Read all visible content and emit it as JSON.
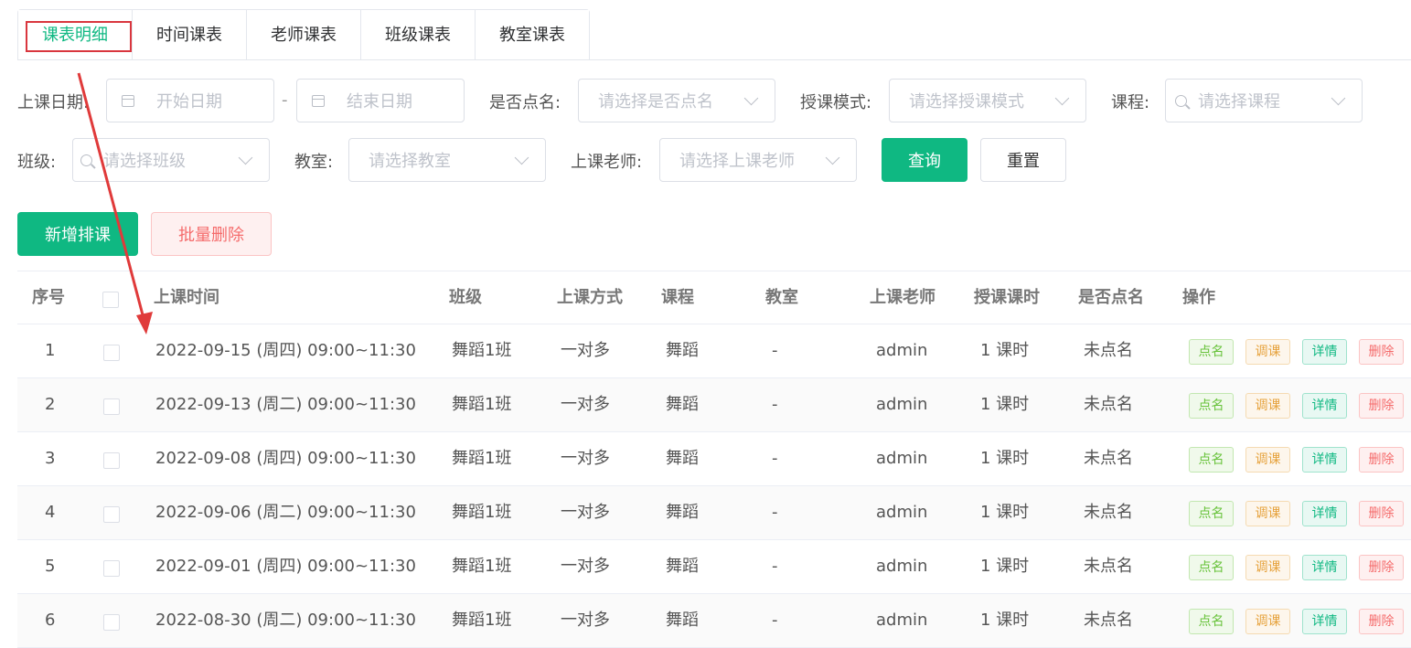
{
  "tabs": [
    "课表明细",
    "时间课表",
    "老师课表",
    "班级课表",
    "教室课表"
  ],
  "filters": {
    "date_label": "上课日期:",
    "start_placeholder": "开始日期",
    "date_sep": "-",
    "end_placeholder": "结束日期",
    "rollcall_label": "是否点名:",
    "rollcall_placeholder": "请选择是否点名",
    "mode_label": "授课模式:",
    "mode_placeholder": "请选择授课模式",
    "course_label": "课程:",
    "course_placeholder": "请选择课程",
    "class_label": "班级:",
    "class_placeholder": "请选择班级",
    "room_label": "教室:",
    "room_placeholder": "请选择教室",
    "teacher_label": "上课老师:",
    "teacher_placeholder": "请选择上课老师",
    "query_button": "查询",
    "reset_button": "重置"
  },
  "actions": {
    "add_button": "新增排课",
    "batch_delete_button": "批量删除"
  },
  "table": {
    "headers": {
      "index": "序号",
      "time": "上课时间",
      "class": "班级",
      "method": "上课方式",
      "course": "课程",
      "room": "教室",
      "teacher": "上课老师",
      "hours": "授课课时",
      "rollcall": "是否点名",
      "ops": "操作"
    },
    "row_actions": {
      "rollcall": "点名",
      "adjust": "调课",
      "detail": "详情",
      "delete": "删除"
    },
    "rows": [
      {
        "index": "1",
        "time": "2022-09-15 (周四) 09:00~11:30",
        "class": "舞蹈1班",
        "method": "一对多",
        "course": "舞蹈",
        "room": "-",
        "teacher": "admin",
        "hours": "1 课时",
        "rollcall": "未点名"
      },
      {
        "index": "2",
        "time": "2022-09-13 (周二) 09:00~11:30",
        "class": "舞蹈1班",
        "method": "一对多",
        "course": "舞蹈",
        "room": "-",
        "teacher": "admin",
        "hours": "1 课时",
        "rollcall": "未点名"
      },
      {
        "index": "3",
        "time": "2022-09-08 (周四) 09:00~11:30",
        "class": "舞蹈1班",
        "method": "一对多",
        "course": "舞蹈",
        "room": "-",
        "teacher": "admin",
        "hours": "1 课时",
        "rollcall": "未点名"
      },
      {
        "index": "4",
        "time": "2022-09-06 (周二) 09:00~11:30",
        "class": "舞蹈1班",
        "method": "一对多",
        "course": "舞蹈",
        "room": "-",
        "teacher": "admin",
        "hours": "1 课时",
        "rollcall": "未点名"
      },
      {
        "index": "5",
        "time": "2022-09-01 (周四) 09:00~11:30",
        "class": "舞蹈1班",
        "method": "一对多",
        "course": "舞蹈",
        "room": "-",
        "teacher": "admin",
        "hours": "1 课时",
        "rollcall": "未点名"
      },
      {
        "index": "6",
        "time": "2022-08-30 (周二) 09:00~11:30",
        "class": "舞蹈1班",
        "method": "一对多",
        "course": "舞蹈",
        "room": "-",
        "teacher": "admin",
        "hours": "1 课时",
        "rollcall": "未点名"
      }
    ]
  },
  "colors": {
    "primary": "#0fb882",
    "annotation_red": "#d9363e"
  }
}
